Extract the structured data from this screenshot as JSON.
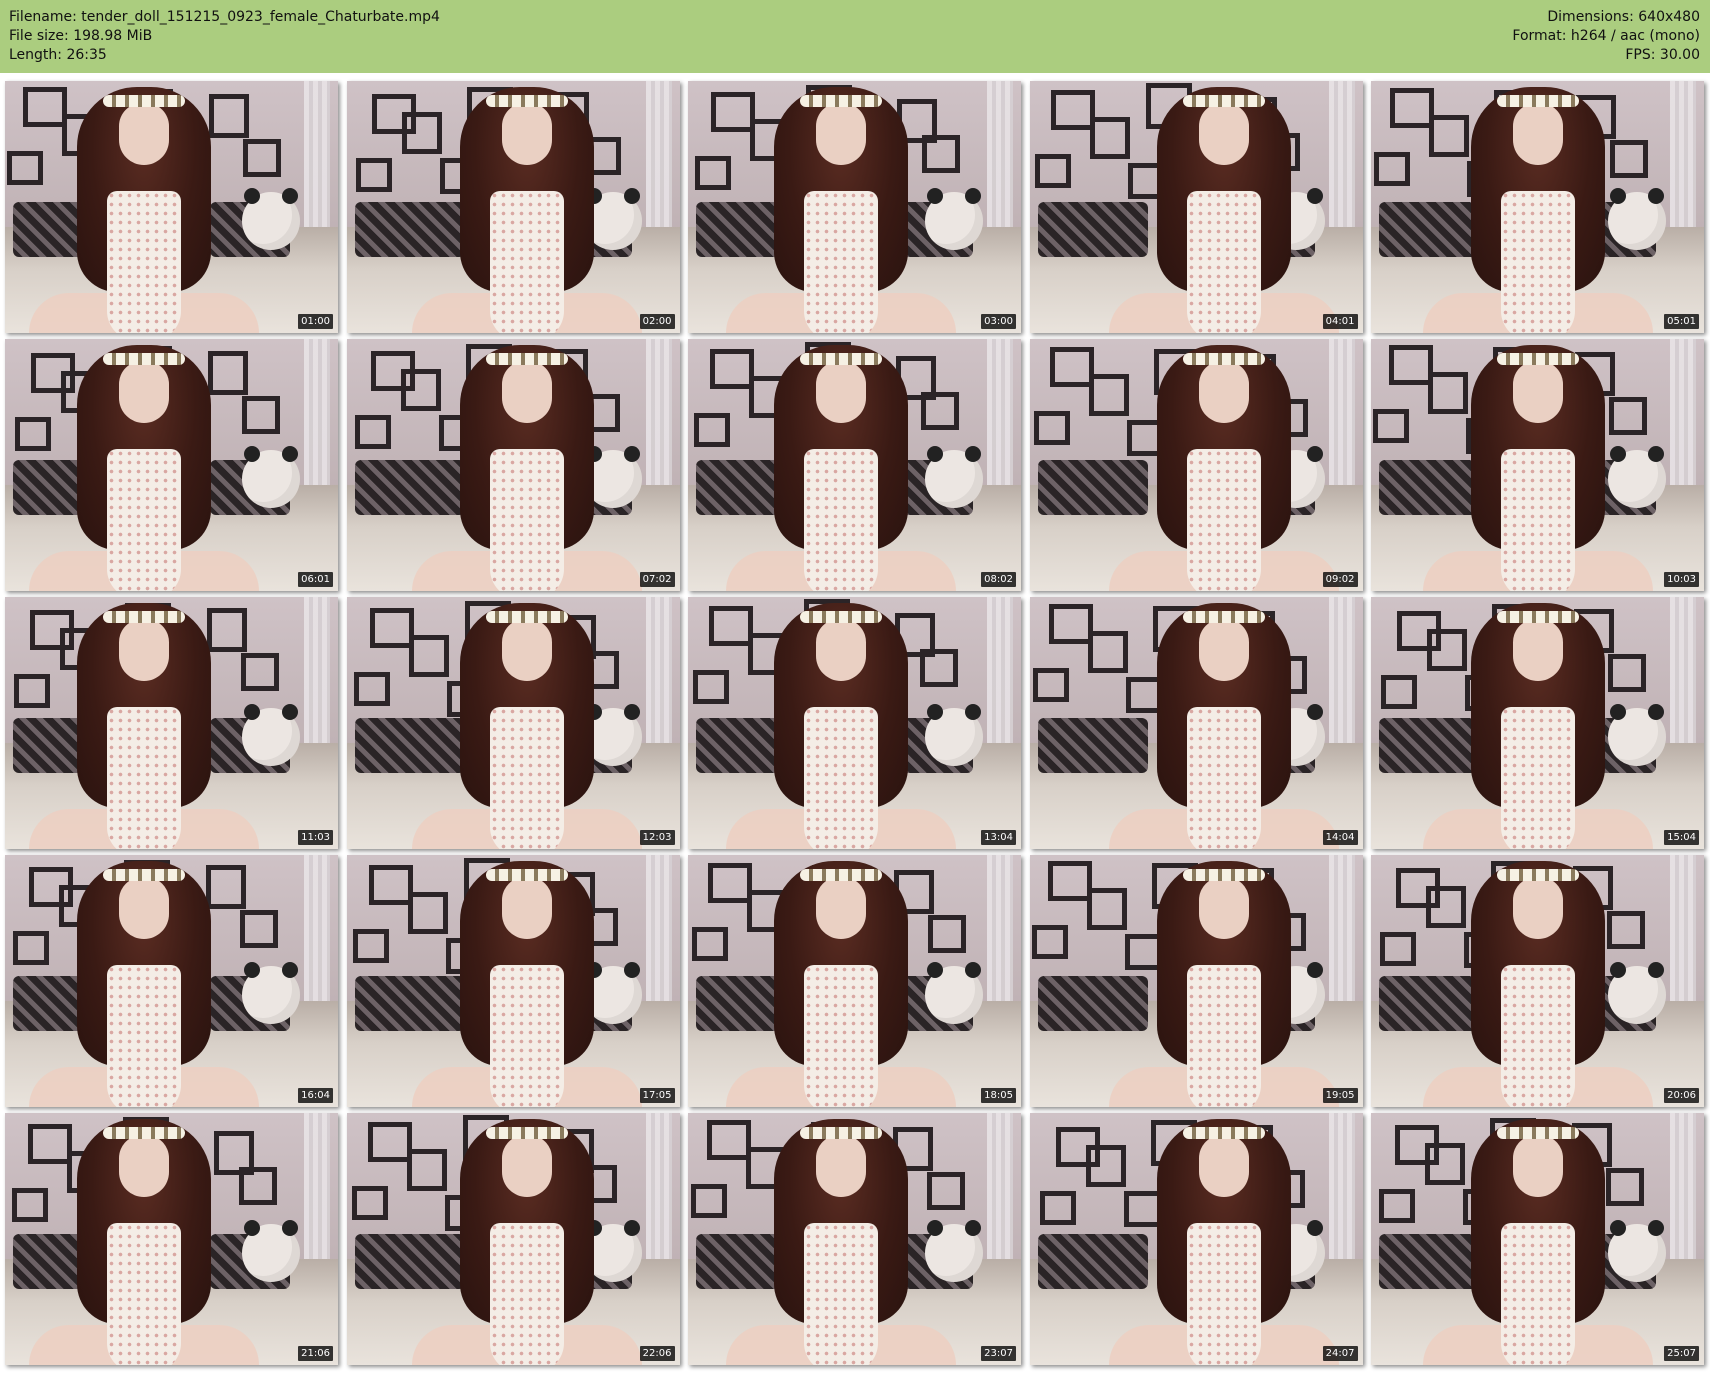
{
  "header": {
    "filename": "Filename: tender_doll_151215_0923_female_Chaturbate.mp4",
    "file_size": "File size: 198.98 MiB",
    "length": "Length: 26:35",
    "dimensions": "Dimensions: 640x480",
    "format": "Format: h264 / aac (mono)",
    "fps": "FPS: 30.00"
  },
  "colors": {
    "header_background": "#abcd7f",
    "timestamp_background": "#000000",
    "timestamp_text": "#ffffff"
  },
  "thumbnails": [
    {
      "timestamp": "01:00"
    },
    {
      "timestamp": "02:00"
    },
    {
      "timestamp": "03:00"
    },
    {
      "timestamp": "04:01"
    },
    {
      "timestamp": "05:01"
    },
    {
      "timestamp": "06:01"
    },
    {
      "timestamp": "07:02"
    },
    {
      "timestamp": "08:02"
    },
    {
      "timestamp": "09:02"
    },
    {
      "timestamp": "10:03"
    },
    {
      "timestamp": "11:03"
    },
    {
      "timestamp": "12:03"
    },
    {
      "timestamp": "13:04"
    },
    {
      "timestamp": "14:04"
    },
    {
      "timestamp": "15:04"
    },
    {
      "timestamp": "16:04"
    },
    {
      "timestamp": "17:05"
    },
    {
      "timestamp": "18:05"
    },
    {
      "timestamp": "19:05"
    },
    {
      "timestamp": "20:06"
    },
    {
      "timestamp": "21:06"
    },
    {
      "timestamp": "22:06"
    },
    {
      "timestamp": "23:07"
    },
    {
      "timestamp": "24:07"
    },
    {
      "timestamp": "25:07"
    }
  ]
}
